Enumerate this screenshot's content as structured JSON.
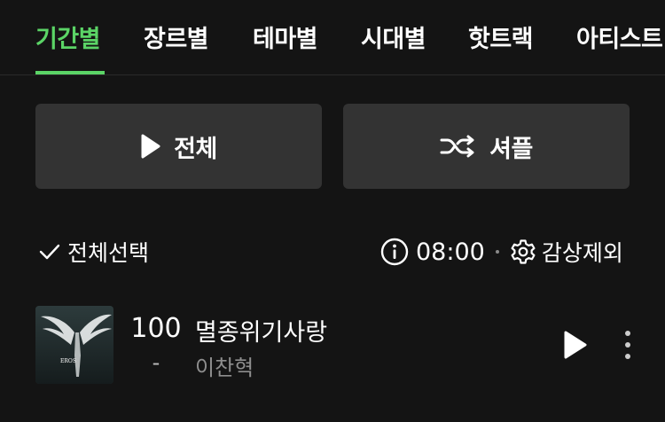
{
  "tabs": [
    {
      "label": "기간별",
      "active": true
    },
    {
      "label": "장르별",
      "active": false
    },
    {
      "label": "테마별",
      "active": false
    },
    {
      "label": "시대별",
      "active": false
    },
    {
      "label": "핫트랙",
      "active": false
    },
    {
      "label": "아티스트",
      "active": false
    }
  ],
  "actions": {
    "play_all_label": "전체",
    "shuffle_label": "셔플"
  },
  "toolbar": {
    "select_all_label": "전체선택",
    "time": "08:00",
    "exclude_label": "감상제외"
  },
  "tracks": [
    {
      "rank": "100",
      "rank_change": "-",
      "title": "멸종위기사랑",
      "artist": "이찬혁",
      "cover_text": "EROS"
    }
  ],
  "colors": {
    "accent": "#5bd466",
    "background": "#141414",
    "button_bg": "#333333"
  }
}
